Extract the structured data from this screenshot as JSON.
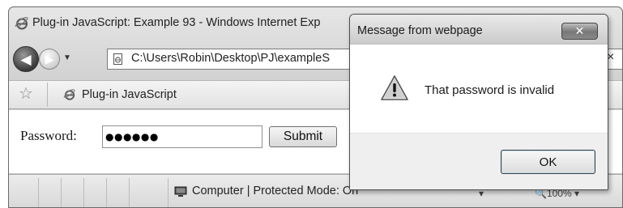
{
  "browser": {
    "title": "Plug-in JavaScript: Example 93 - Windows Internet Exp",
    "address": "C:\\Users\\Robin\\Desktop\\PJ\\exampleS",
    "tab_label": "Plug-in JavaScript",
    "nav_close_glyph": "×",
    "back_glyph": "◀",
    "forward_glyph": "▶",
    "dropdown_glyph": "▼",
    "star_glyph": "☆"
  },
  "page": {
    "password_label": "Password:",
    "password_value": "●●●●●●",
    "submit_label": "Submit"
  },
  "statusbar": {
    "zone_text": "Computer | Protected Mode: On",
    "security_ctl": "▾",
    "zoom_text": "🔍100%  ▾"
  },
  "dialog": {
    "title": "Message from webpage",
    "close_glyph": "✕",
    "message": "That password is invalid",
    "ok_label": "OK",
    "icon": "warning-icon"
  },
  "colors": {
    "dialog_footer": "#efefef",
    "window_chrome": "#cfcfcf"
  }
}
